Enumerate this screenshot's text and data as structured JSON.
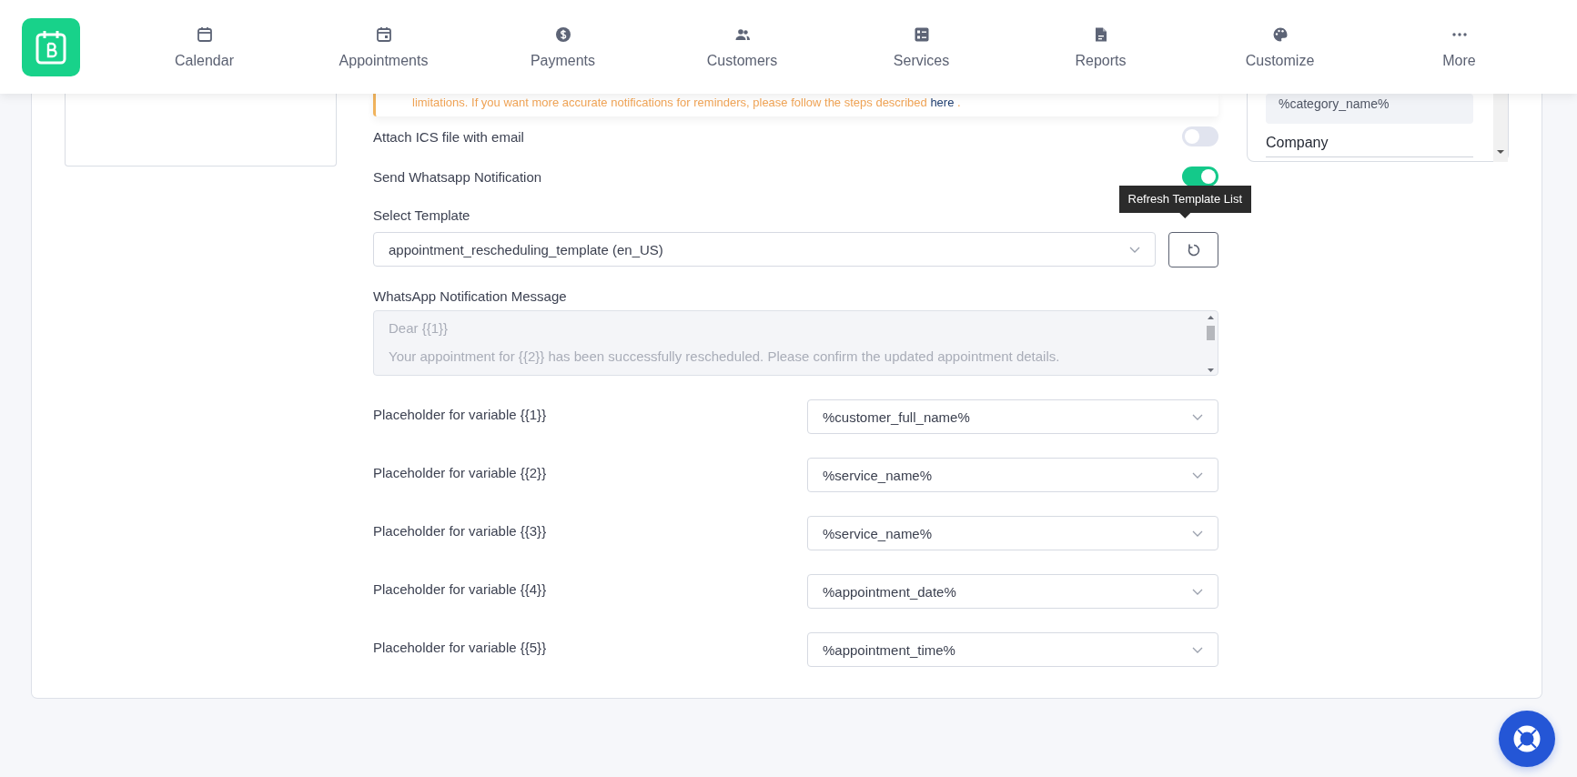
{
  "nav": {
    "items": [
      {
        "label": "Calendar",
        "selected": false
      },
      {
        "label": "Appointments",
        "selected": false
      },
      {
        "label": "Payments",
        "selected": false
      },
      {
        "label": "Customers",
        "selected": false
      },
      {
        "label": "Services",
        "selected": false
      },
      {
        "label": "Reports",
        "selected": false
      },
      {
        "label": "Customize",
        "selected": false
      },
      {
        "label": "More",
        "selected": false
      }
    ]
  },
  "notice": {
    "text": "limitations. If you want more accurate notifications for reminders, please follow the steps described ",
    "link": "here",
    "end": " ."
  },
  "toggles": [
    {
      "label": "Attach ICS file with email",
      "on": false
    },
    {
      "label": "Send Whatsapp Notification",
      "on": true
    }
  ],
  "template": {
    "label": "Select Template",
    "value": "appointment_rescheduling_template (en_US)",
    "refresh_tooltip": "Refresh Template List"
  },
  "message": {
    "label": "WhatsApp Notification Message",
    "lines": [
      "Dear {{1}}",
      "Your appointment for {{2}} has been successfully rescheduled. Please confirm the updated appointment details."
    ]
  },
  "placeholders": [
    {
      "label": "Placeholder for variable {{1}}",
      "value": "%customer_full_name%"
    },
    {
      "label": "Placeholder for variable {{2}}",
      "value": "%service_name%"
    },
    {
      "label": "Placeholder for variable {{3}}",
      "value": "%service_name%"
    },
    {
      "label": "Placeholder for variable {{4}}",
      "value": "%appointment_date%"
    },
    {
      "label": "Placeholder for variable {{5}}",
      "value": "%appointment_time%"
    }
  ],
  "right_panel": {
    "items": [
      {
        "kind": "chip",
        "text": "%category_name%"
      },
      {
        "kind": "heading",
        "text": "Company"
      }
    ]
  }
}
